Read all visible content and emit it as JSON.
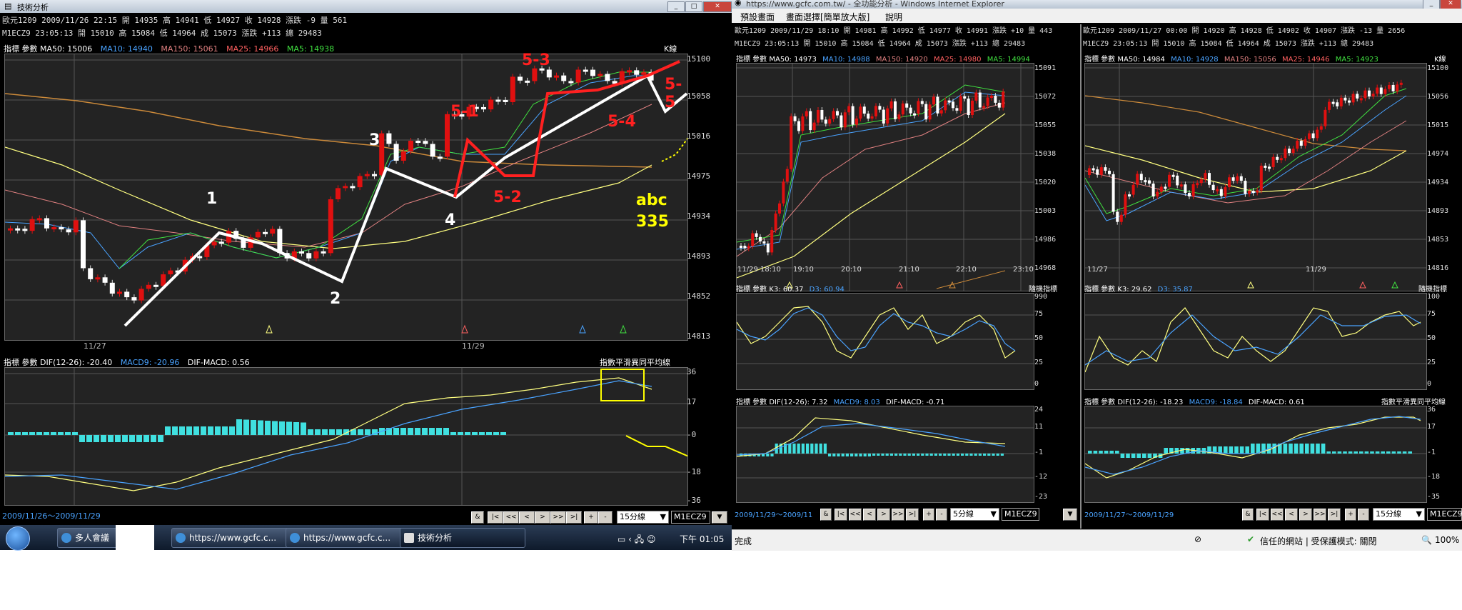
{
  "left": {
    "title": "技術分析",
    "info1": "歐元1209 2009/11/26 22:15 開 14935 高 14941 低 14927 收 14928 漲跌 -9  量 561",
    "info2": "M1ECZ9   23:05:13   開 15010 高 15084 低 14964 成 15073 漲跌 +113 總 29483",
    "main_label": "指標  參數  MA50: 15006",
    "ma10": "MA10: 14940",
    "ma150": "MA150: 15061",
    "ma25": "MA25: 14966",
    "ma5": "MA5: 14938",
    "ksign": "K線",
    "yticks": [
      "15100",
      "15058",
      "15016",
      "14975",
      "14934",
      "14893",
      "14852",
      "14813"
    ],
    "xticks": [
      "11/27",
      "11/29"
    ],
    "annotations": {
      "w1": "1",
      "w2": "2",
      "w3": "3",
      "w4": "4",
      "w51": "5-1",
      "w52": "5-2",
      "w53": "5-3",
      "w54": "5-4",
      "w55": "5-5",
      "abc": "abc",
      "abc_val": "335"
    },
    "macd_label": "指標  參數  DIF(12-26): -20.40",
    "macd9": "MACD9: -20.96",
    "difmacd": "DIF-MACD: 0.56",
    "macd_title": "指數平滑異同平均線",
    "macd_yticks": [
      "36",
      "17",
      "-0",
      "-18",
      "-36"
    ],
    "date_range": "2009/11/26～2009/11/29",
    "nav": [
      "&",
      "|<",
      "<<",
      "<",
      ">",
      ">>",
      ">|",
      "+",
      "-"
    ],
    "interval": "15分線",
    "symbol": "M1ECZ9"
  },
  "taskbar": {
    "items": [
      "多人會議",
      "https://www.gcfc.c...",
      "https://www.gcfc.c...",
      "技術分析"
    ],
    "time": "下午 01:05"
  },
  "ie": {
    "title": "https://www.gcfc.com.tw/ - 全功能分析 - Windows Internet Explorer",
    "menu": [
      "預設畫面",
      "畫面選擇[簡單放大版]",
      "說明"
    ],
    "status": "完成",
    "trust": "信任的網站 | 受保護模式: 關閉",
    "zoom": "100%"
  },
  "mid": {
    "info1": "歐元1209 2009/11/29 18:10 開 14981 高 14992 低 14977 收 14991 漲跌 +10  量 443",
    "info2": "M1ECZ9   23:05:13   開 15010 高 15084 低 14964 成 15073 漲跌 +113 總 29483",
    "main_label": "指標  參數  MA50: 14973",
    "ma10": "MA10: 14988",
    "ma150": "MA150: 14920",
    "ma25": "MA25: 14980",
    "ma5": "MA5: 14994",
    "yticks": [
      "15091",
      "15072",
      "15055",
      "15038",
      "15020",
      "15003",
      "14986",
      "14968"
    ],
    "xticks": [
      "11/29 18:10",
      "19:10",
      "20:10",
      "21:10",
      "22:10",
      "23:10"
    ],
    "kd_label": "指標  參數  K3: 60.37",
    "d3": "D3: 60.94",
    "kd_title": "隨機指標",
    "kd_yticks": [
      "990",
      "75",
      "50",
      "25",
      "0"
    ],
    "macd_label": "指標  參數  DIF(12-26): 7.32",
    "macd9": "MACD9: 8.03",
    "difmacd": "DIF-MACD: -0.71",
    "macd_yticks": [
      "24",
      "11",
      "-1",
      "-12",
      "-23"
    ],
    "date_range": "2009/11/29～2009/11",
    "interval": "5分線",
    "symbol": "M1ECZ9"
  },
  "right": {
    "info1": "歐元1209 2009/11/27 00:00 開 14920 高 14928 低 14902 收 14907 漲跌 -13  量 2656",
    "info2": "M1ECZ9   23:05:13   開 15010 高 15084 低 14964 成 15073 漲跌 +113 總 29483",
    "main_label": "指標  參數  MA50: 14984",
    "ma10": "MA10: 14928",
    "ma150": "MA150: 15056",
    "ma25": "MA25: 14946",
    "ma5": "MA5: 14923",
    "ksign": "K線",
    "yticks": [
      "15100",
      "15056",
      "15015",
      "14974",
      "14934",
      "14893",
      "14853",
      "14816"
    ],
    "xticks": [
      "11/27",
      "11/29"
    ],
    "kd_label": "指標  參數  K3: 29.62",
    "d3": "D3: 35.87",
    "kd_title": "隨機指標",
    "kd_yticks": [
      "100",
      "75",
      "50",
      "25",
      "0"
    ],
    "macd_label": "指標  參數  DIF(12-26): -18.23",
    "macd9": "MACD9: -18.84",
    "difmacd": "DIF-MACD: 0.61",
    "macd_title": "指數平滑異同平均線",
    "macd_yticks": [
      "36",
      "17",
      "-1",
      "-18",
      "-35"
    ],
    "date_range": "2009/11/27～2009/11/29",
    "interval": "15分線",
    "symbol": "M1ECZ9"
  },
  "colors": {
    "up": "#e01010",
    "down": "#ffffff",
    "ma50": "#ffff80",
    "ma10": "#4aa3ff",
    "ma150": "#e08080",
    "ma25": "#ff6060",
    "ma5": "#40e040",
    "wave_white": "#ffffff",
    "wave_red": "#ff2020",
    "hist": "#40e0e0",
    "abc": "#ffff00"
  }
}
